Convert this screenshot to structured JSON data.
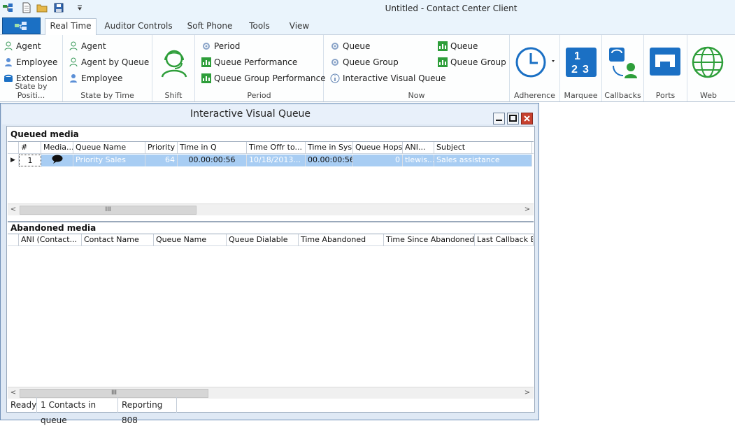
{
  "window": {
    "title": "Untitled - Contact Center Client"
  },
  "quick_access": [
    "app-icon",
    "new-document-icon",
    "open-folder-icon",
    "save-icon",
    "customize-dropdown-icon"
  ],
  "tabs": [
    {
      "label": "Real Time",
      "active": true
    },
    {
      "label": "Auditor Controls"
    },
    {
      "label": "Soft Phone"
    },
    {
      "label": "Tools"
    },
    {
      "label": "View"
    }
  ],
  "ribbon": {
    "state_by_position": {
      "label": "State by Positi...",
      "items": [
        "Agent",
        "Employee",
        "Extension"
      ]
    },
    "state_by_time": {
      "label": "State by Time",
      "items": [
        "Agent",
        "Agent by Queue",
        "Employee"
      ]
    },
    "shift": {
      "label": "Shift"
    },
    "period": {
      "label": "Period",
      "items": [
        "Period",
        "Queue Performance",
        "Queue Group Performance"
      ]
    },
    "now": {
      "label": "Now",
      "col1": [
        "Queue",
        "Queue Group",
        "Interactive Visual Queue"
      ],
      "col2": [
        "Queue",
        "Queue Group"
      ]
    },
    "adherence": {
      "label": "Adherence"
    },
    "marquee": {
      "label": "Marquee"
    },
    "callbacks": {
      "label": "Callbacks"
    },
    "ports": {
      "label": "Ports"
    },
    "web": {
      "label": "Web"
    }
  },
  "child_window": {
    "title": "Interactive Visual Queue",
    "queued": {
      "section_label": "Queued media",
      "columns": [
        "#",
        "Media...",
        "Queue Name",
        "Priority",
        "Time in Q",
        "Time Offr to...",
        "Time in Sys",
        "Queue Hops",
        "ANI...",
        "Subject"
      ],
      "rows": [
        {
          "num": "1",
          "media": "chat-bubble-icon",
          "queue_name": "Priority Sales",
          "priority": "64",
          "time_in_q": "00.00:00:56",
          "time_offr": "10/18/2013...",
          "time_in_sys": "00.00:00:56",
          "queue_hops": "0",
          "ani": "tlewis...",
          "subject": "Sales assistance"
        }
      ],
      "scroll_label": "III"
    },
    "abandoned": {
      "section_label": "Abandoned media",
      "columns": [
        "ANI (Contact...",
        "Contact Name",
        "Queue Name",
        "Queue Dialable",
        "Time Abandoned",
        "Time Since Abandoned",
        "Last Callback Emp"
      ],
      "scroll_label": "III"
    },
    "status": {
      "state": "Ready",
      "contacts": "1 Contacts in queue",
      "reporting": "Reporting 808"
    }
  },
  "colors": {
    "accent": "#1b70c4",
    "selected_row": "#a8cdf3",
    "ribbon_icon_green": "#2e9e3a"
  }
}
